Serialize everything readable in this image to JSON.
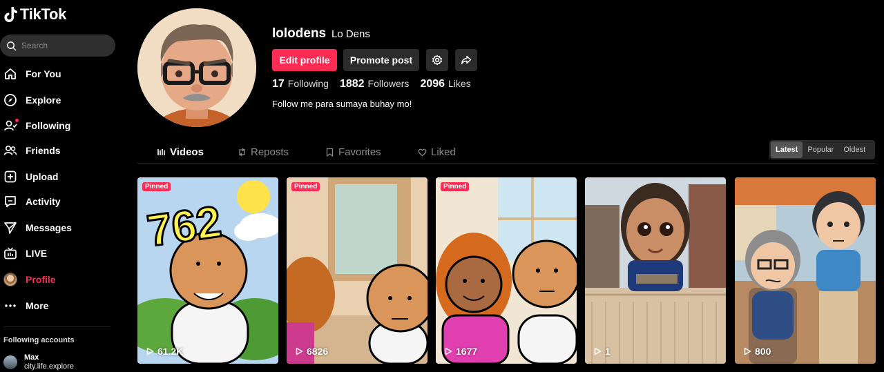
{
  "app": {
    "brand": "TikTok",
    "accent_color": "#fe2c55"
  },
  "search": {
    "placeholder": "Search"
  },
  "sidebar": {
    "items": [
      {
        "label": "For You",
        "icon": "home-icon"
      },
      {
        "label": "Explore",
        "icon": "compass-icon"
      },
      {
        "label": "Following",
        "icon": "following-icon",
        "notification_dot": true
      },
      {
        "label": "Friends",
        "icon": "friends-icon"
      },
      {
        "label": "Upload",
        "icon": "upload-icon"
      },
      {
        "label": "Activity",
        "icon": "activity-icon"
      },
      {
        "label": "Messages",
        "icon": "messages-icon"
      },
      {
        "label": "LIVE",
        "icon": "live-icon"
      },
      {
        "label": "Profile",
        "icon": "avatar",
        "active": true
      },
      {
        "label": "More",
        "icon": "more-icon"
      }
    ],
    "following_accounts_heading": "Following accounts",
    "accounts": [
      {
        "name": "Max",
        "handle": "city.life.explore"
      }
    ]
  },
  "profile": {
    "username": "lolodens",
    "nickname": "Lo Dens",
    "edit_label": "Edit profile",
    "promote_label": "Promote post",
    "stats": {
      "following_count": "17",
      "following_label": "Following",
      "followers_count": "1882",
      "followers_label": "Followers",
      "likes_count": "2096",
      "likes_label": "Likes"
    },
    "bio": "Follow me para sumaya buhay mo!"
  },
  "tabs": [
    {
      "label": "Videos",
      "icon": "grid-icon",
      "active": true
    },
    {
      "label": "Reposts",
      "icon": "repost-icon"
    },
    {
      "label": "Favorites",
      "icon": "bookmark-icon"
    },
    {
      "label": "Liked",
      "icon": "heart-icon"
    }
  ],
  "sort": {
    "options": [
      "Latest",
      "Popular",
      "Oldest"
    ],
    "selected": "Latest"
  },
  "videos": [
    {
      "pinned_label": "Pinned",
      "views": "61.2K",
      "overlay_text": "762"
    },
    {
      "pinned_label": "Pinned",
      "views": "6826"
    },
    {
      "pinned_label": "Pinned",
      "views": "1677"
    },
    {
      "views": "1"
    },
    {
      "views": "800"
    }
  ]
}
